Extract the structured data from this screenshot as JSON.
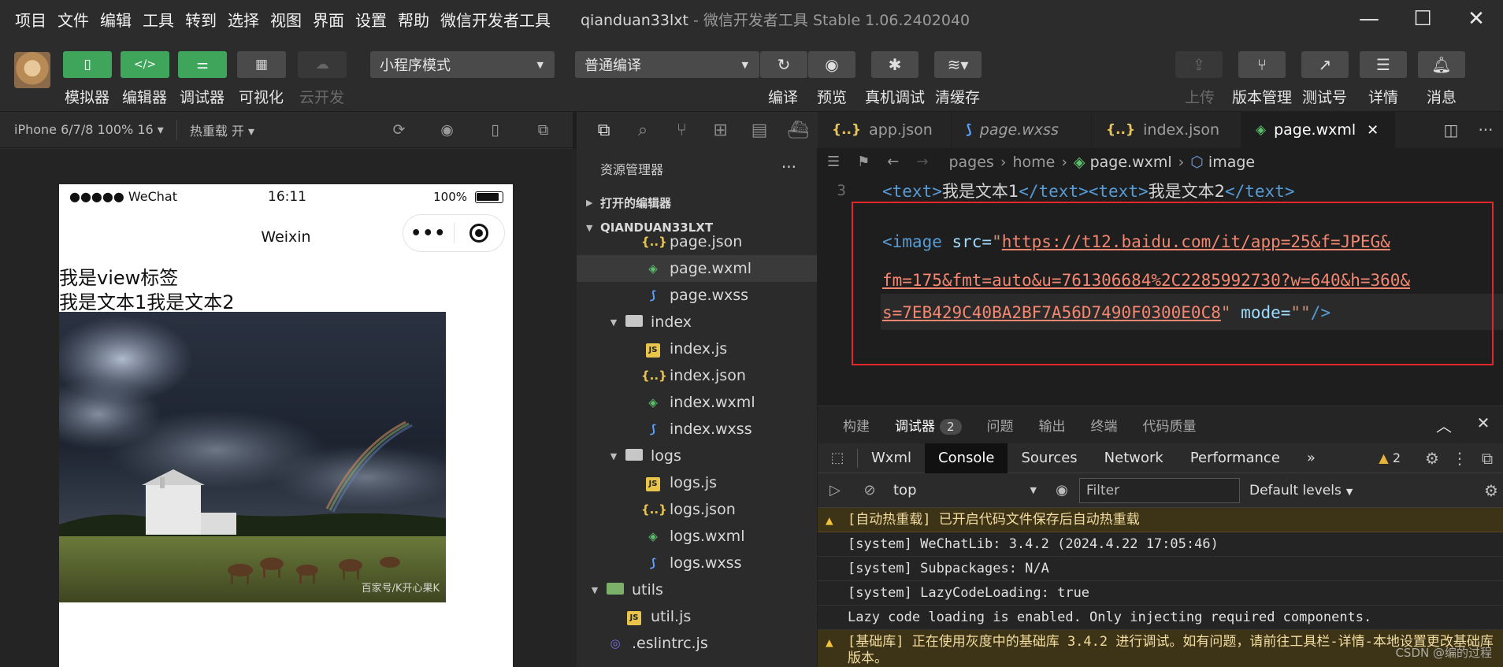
{
  "menubar": {
    "menus": [
      "项目",
      "文件",
      "编辑",
      "工具",
      "转到",
      "选择",
      "视图",
      "界面",
      "设置",
      "帮助",
      "微信开发者工具"
    ],
    "project": "qianduan33lxt",
    "title": "- 微信开发者工具 Stable 1.06.2402040"
  },
  "toolbar": {
    "simulator": "模拟器",
    "editor": "编辑器",
    "debugger": "调试器",
    "visual": "可视化",
    "cloud": "云开发",
    "mode_select": "小程序模式",
    "compile_select": "普通编译",
    "compile": "编译",
    "preview": "预览",
    "real_debug": "真机调试",
    "clear_cache": "清缓存",
    "upload": "上传",
    "version": "版本管理",
    "test_id": "测试号",
    "details": "详情",
    "messages": "消息"
  },
  "simulator_bar": {
    "device": "iPhone 6/7/8 100% 16 ▾",
    "hot_reload": "热重载 开 ▾"
  },
  "phone": {
    "signal": "●●●●● WeChat",
    "time": "16:11",
    "battery": "100%",
    "nav_title": "Weixin",
    "view_text": "我是view标签",
    "text1": "我是文本1",
    "text2": "我是文本2",
    "watermark": "百家号/K开心果K"
  },
  "explorer": {
    "title": "资源管理器",
    "open_editors": "打开的编辑器",
    "project": "QIANDUAN33LXT",
    "files": [
      {
        "name": "page.json",
        "type": "json",
        "indent": 2
      },
      {
        "name": "page.wxml",
        "type": "wxml",
        "indent": 2,
        "selected": true
      },
      {
        "name": "page.wxss",
        "type": "wxss",
        "indent": 2
      },
      {
        "name": "index",
        "type": "folder",
        "indent": 1,
        "open": true
      },
      {
        "name": "index.js",
        "type": "js",
        "indent": 2
      },
      {
        "name": "index.json",
        "type": "json",
        "indent": 2
      },
      {
        "name": "index.wxml",
        "type": "wxml",
        "indent": 2
      },
      {
        "name": "index.wxss",
        "type": "wxss",
        "indent": 2
      },
      {
        "name": "logs",
        "type": "folder",
        "indent": 1,
        "open": true
      },
      {
        "name": "logs.js",
        "type": "js",
        "indent": 2
      },
      {
        "name": "logs.json",
        "type": "json",
        "indent": 2
      },
      {
        "name": "logs.wxml",
        "type": "wxml",
        "indent": 2
      },
      {
        "name": "logs.wxss",
        "type": "wxss",
        "indent": 2
      },
      {
        "name": "utils",
        "type": "folder-green",
        "indent": 0,
        "open": true
      },
      {
        "name": "util.js",
        "type": "js",
        "indent": 1
      },
      {
        "name": ".eslintrc.js",
        "type": "eslint",
        "indent": 0
      }
    ]
  },
  "editor": {
    "tabs": [
      {
        "icon": "{..}",
        "name": "app.json",
        "kind": "json"
      },
      {
        "icon": "⟆",
        "name": "page.wxss",
        "kind": "wxss",
        "italic": true
      },
      {
        "icon": "{..}",
        "name": "index.json",
        "kind": "json"
      },
      {
        "icon": "◈",
        "name": "page.wxml",
        "kind": "wxml",
        "active": true
      }
    ],
    "close_glyph": "✕",
    "breadcrumbs": [
      "pages",
      "home",
      "page.wxml",
      "image"
    ],
    "line3_no": "3",
    "line3": {
      "t1_open": "<text>",
      "t1_body": "我是文本1",
      "t1_close": "</text>",
      "t2_open": "<text>",
      "t2_body": "我是文本2",
      "t2_close": "</text>"
    },
    "image_line": {
      "open": "<image",
      "attr_src": " src=",
      "quote": "\"",
      "url_part1": "https://t12.baidu.com/it/app=25&f=JPEG&",
      "url_part2": "fm=175&fmt=auto&u=761306684%2C2285992730?w=640&h=360&",
      "url_part3": "s=7EB429C40BA2BF7A56D7490F0300E0C8",
      "attr_mode": " mode=",
      "mode_val": "\"\"",
      "close": "/>"
    }
  },
  "debugger": {
    "top_tabs": [
      "构建",
      "调试器",
      "问题",
      "输出",
      "终端",
      "代码质量"
    ],
    "debugger_badge": "2",
    "dev_tabs": [
      "Wxml",
      "Console",
      "Sources",
      "Network",
      "Performance"
    ],
    "more": "»",
    "warn_count": "2",
    "context": "top",
    "filter_placeholder": "Filter",
    "levels": "Default levels",
    "console": [
      {
        "level": "warn",
        "text": "[自动热重载] 已开启代码文件保存后自动热重载"
      },
      {
        "level": "info",
        "text": "[system] WeChatLib: 3.4.2 (2024.4.22 17:05:46)"
      },
      {
        "level": "info",
        "text": "[system] Subpackages: N/A"
      },
      {
        "level": "info",
        "text": "[system] LazyCodeLoading: true"
      },
      {
        "level": "info",
        "text": "Lazy code loading is enabled. Only injecting required components."
      },
      {
        "level": "warn",
        "text": "[基础库] 正在使用灰度中的基础库 3.4.2 进行调试。如有问题，请前往工具栏-详情-本地设置更改基础库版本。"
      }
    ],
    "credit": "CSDN @编的过程"
  }
}
